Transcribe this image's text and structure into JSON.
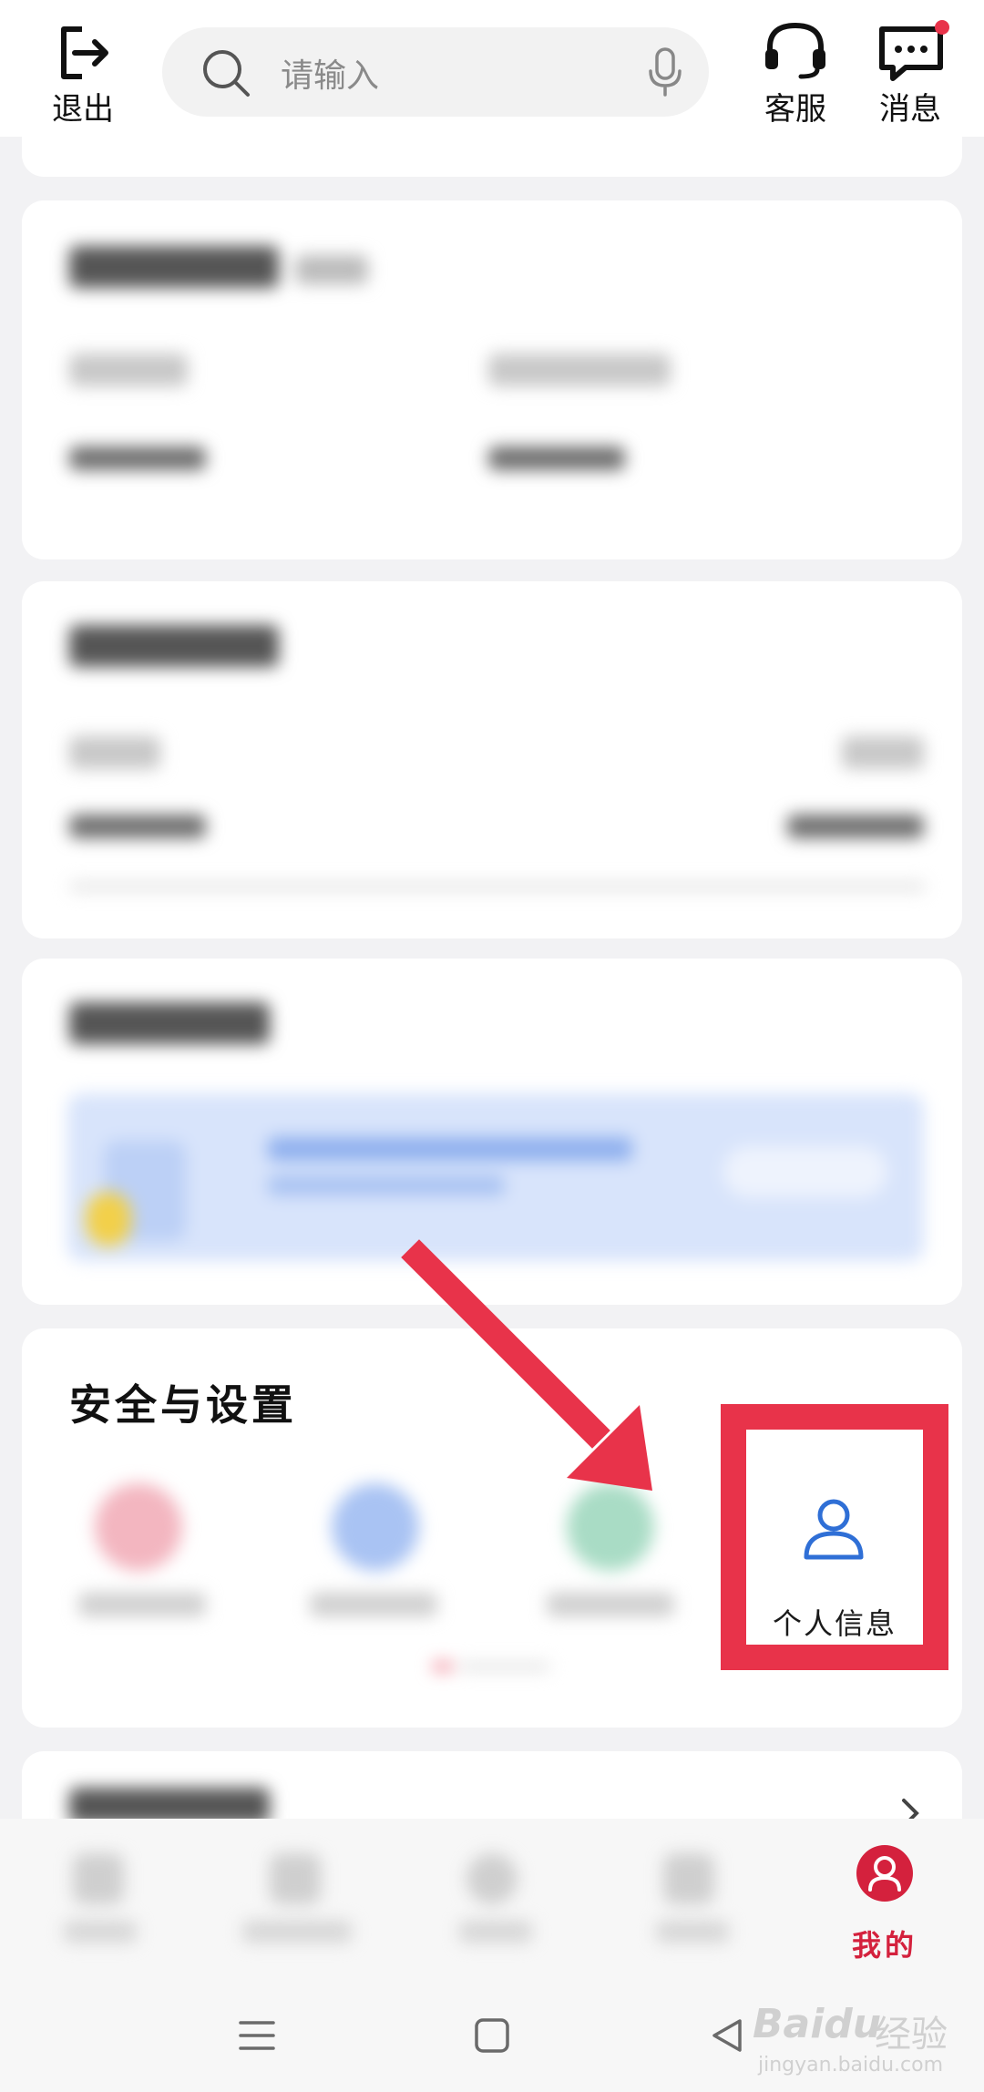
{
  "header": {
    "logout_label": "退出",
    "search_placeholder": "请输入",
    "service_label": "客服",
    "messages_label": "消息"
  },
  "security_section": {
    "title": "安全与设置",
    "personal_info_label": "个人信息"
  },
  "tabbar": {
    "mine_label": "我的"
  },
  "watermark": {
    "brand": "Baidu",
    "cn": "经验",
    "url": "jingyan.baidu.com"
  },
  "colors": {
    "accent_red": "#e8334a",
    "icon_blue": "#2f6fd6",
    "tab_active": "#d4213d"
  }
}
